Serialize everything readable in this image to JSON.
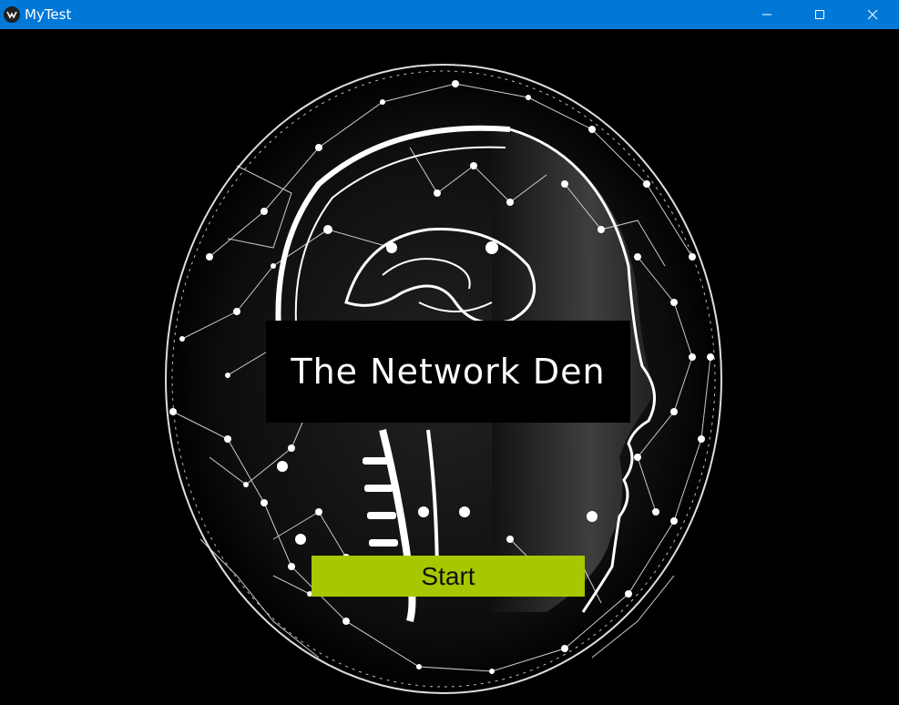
{
  "window": {
    "title": "MyTest",
    "app_icon": "kivy-logo-icon",
    "controls": {
      "minimize_icon": "minimize-icon",
      "maximize_icon": "maximize-icon",
      "close_icon": "close-icon"
    },
    "titlebar_color": "#0078d7"
  },
  "main": {
    "heading": "The Network Den",
    "start_button_label": "Start",
    "start_button_color": "#a8c700",
    "background_image": "neural-network-brain-head-icon"
  }
}
